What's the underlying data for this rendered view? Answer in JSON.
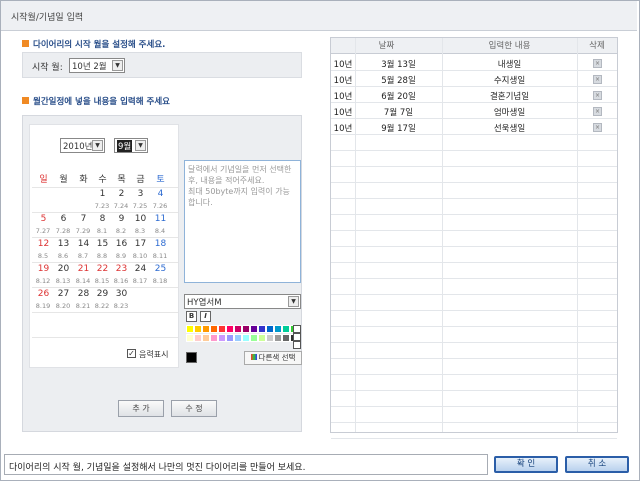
{
  "window": {
    "title": "시작월/기념일 입력"
  },
  "start_section": {
    "heading": "다이어리의 시작 월을 설정해 주세요.",
    "label": "시작 월:",
    "selected": "10년 2월"
  },
  "memo_section": {
    "heading": "월간일정에 넣을 내용을 입력해 주세요"
  },
  "calendar": {
    "year": "2010년",
    "month": "9월",
    "weekdays": [
      "일",
      "월",
      "화",
      "수",
      "목",
      "금",
      "토"
    ],
    "weeks": [
      [
        {
          "d": "",
          "l": ""
        },
        {
          "d": "",
          "l": ""
        },
        {
          "d": "",
          "l": ""
        },
        {
          "d": "1",
          "l": "7.23"
        },
        {
          "d": "2",
          "l": "7.24"
        },
        {
          "d": "3",
          "l": "7.25"
        },
        {
          "d": "4",
          "l": "7.26"
        }
      ],
      [
        {
          "d": "5",
          "l": "7.27"
        },
        {
          "d": "6",
          "l": "7.28"
        },
        {
          "d": "7",
          "l": "7.29"
        },
        {
          "d": "8",
          "l": "8.1"
        },
        {
          "d": "9",
          "l": "8.2"
        },
        {
          "d": "10",
          "l": "8.3"
        },
        {
          "d": "11",
          "l": "8.4"
        }
      ],
      [
        {
          "d": "12",
          "l": "8.5"
        },
        {
          "d": "13",
          "l": "8.6"
        },
        {
          "d": "14",
          "l": "8.7"
        },
        {
          "d": "15",
          "l": "8.8"
        },
        {
          "d": "16",
          "l": "8.9"
        },
        {
          "d": "17",
          "l": "8.10"
        },
        {
          "d": "18",
          "l": "8.11"
        }
      ],
      [
        {
          "d": "19",
          "l": "8.12"
        },
        {
          "d": "20",
          "l": "8.13"
        },
        {
          "d": "21",
          "l": "8.14"
        },
        {
          "d": "22",
          "l": "8.15"
        },
        {
          "d": "23",
          "l": "8.16"
        },
        {
          "d": "24",
          "l": "8.17"
        },
        {
          "d": "25",
          "l": "8.18"
        }
      ],
      [
        {
          "d": "26",
          "l": "8.19"
        },
        {
          "d": "27",
          "l": "8.20"
        },
        {
          "d": "28",
          "l": "8.21"
        },
        {
          "d": "29",
          "l": "8.22"
        },
        {
          "d": "30",
          "l": "8.23"
        },
        {
          "d": "",
          "l": ""
        },
        {
          "d": "",
          "l": ""
        }
      ],
      [
        {
          "d": "",
          "l": ""
        },
        {
          "d": "",
          "l": ""
        },
        {
          "d": "",
          "l": ""
        },
        {
          "d": "",
          "l": ""
        },
        {
          "d": "",
          "l": ""
        },
        {
          "d": "",
          "l": ""
        },
        {
          "d": "",
          "l": ""
        }
      ]
    ],
    "red_days": [
      "5",
      "12",
      "19",
      "21",
      "22",
      "23",
      "26"
    ],
    "blue_days": [
      "4",
      "11",
      "18",
      "25"
    ],
    "lunar_toggle": "음력표시",
    "lunar_checked": true
  },
  "editor": {
    "placeholder": "달력에서 기념일을 먼저 선택한 후, 내용을 적어주세요.\n최대 50byte까지 입력이 가능합니다.",
    "font": "HY엽서M",
    "bold": "B",
    "italic": "I",
    "more_colors": "다른색 선택",
    "palette": [
      "#ffff00",
      "#ffcc00",
      "#ff9900",
      "#ff6600",
      "#ff3333",
      "#ff0066",
      "#cc0066",
      "#990066",
      "#660099",
      "#3333cc",
      "#0066cc",
      "#0099cc",
      "#00cc99",
      "#33cc33",
      "#66ff66",
      "#ffffff",
      "#cccccc",
      "#999999",
      "#666666",
      "#333333",
      "#000000",
      "#ffffcc",
      "#ffcccc",
      "#ccccff",
      "#ccffff"
    ]
  },
  "buttons": {
    "add": "추 가",
    "edit": "수 정",
    "ok": "확 인",
    "cancel": "취 소"
  },
  "table": {
    "headers": [
      "날짜",
      "입력한 내용",
      "삭제"
    ],
    "rows": [
      {
        "year": "10년",
        "date": "3월 13일",
        "text": "내생일"
      },
      {
        "year": "10년",
        "date": "5월 28일",
        "text": "수지생일"
      },
      {
        "year": "10년",
        "date": "6월 20일",
        "text": "결혼기념일"
      },
      {
        "year": "10년",
        "date": "7월 7일",
        "text": "엄마생일"
      },
      {
        "year": "10년",
        "date": "9월 17일",
        "text": "선욱생일"
      }
    ]
  },
  "status": {
    "text": "다이어리의 시작 월, 기념일을 설정해서 나만의 멋진 다이어리를 만들어 보세요."
  }
}
